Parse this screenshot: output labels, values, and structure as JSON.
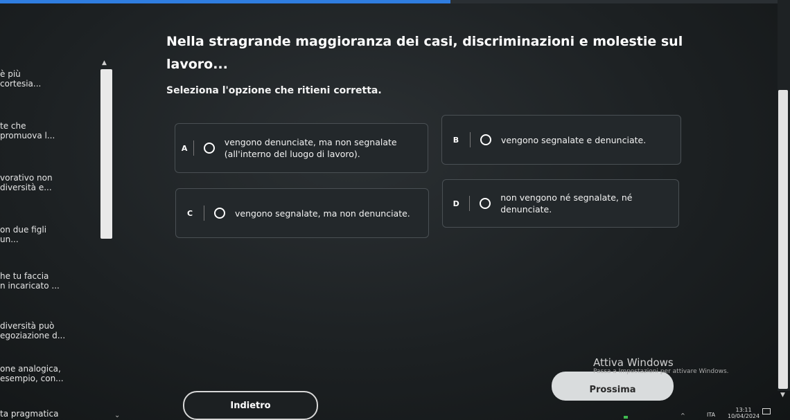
{
  "progress": {
    "percent": 57,
    "color": "#2f7de0"
  },
  "sidebar": {
    "items": [
      {
        "lines": [
          "è più",
          "cortesia..."
        ]
      },
      {
        "lines": [
          "te che",
          "promuova l..."
        ]
      },
      {
        "lines": [
          "vorativo non",
          "diversità e..."
        ]
      },
      {
        "lines": [
          "on due figli",
          "un..."
        ]
      },
      {
        "lines": [
          "he tu faccia",
          "n incaricato ..."
        ]
      },
      {
        "lines": [
          "diversità può",
          "egoziazione d..."
        ]
      },
      {
        "lines": [
          "one analogica,",
          "esempio, con..."
        ]
      },
      {
        "lines": [
          "ta pragmatica"
        ]
      }
    ]
  },
  "question": {
    "title": "Nella stragrande maggioranza dei casi, discriminazioni e molestie sul lavoro...",
    "instruction": "Seleziona l'opzione che ritieni corretta."
  },
  "options": [
    {
      "letter": "A",
      "text": "vengono denunciate, ma non segnalate (all'interno del luogo di lavoro)."
    },
    {
      "letter": "B",
      "text": "vengono segnalate e denunciate."
    },
    {
      "letter": "C",
      "text": "vengono segnalate, ma non denunciate."
    },
    {
      "letter": "D",
      "text": "non vengono né segnalate, né denunciate."
    }
  ],
  "buttons": {
    "back": "Indietro",
    "next": "Prossima"
  },
  "watermark": {
    "title": "Attiva Windows",
    "subtitle": "Passa a Impostazioni per attivare Windows."
  },
  "taskbar": {
    "lang": "ITA",
    "time": "13:11",
    "date": "10/04/2024"
  }
}
